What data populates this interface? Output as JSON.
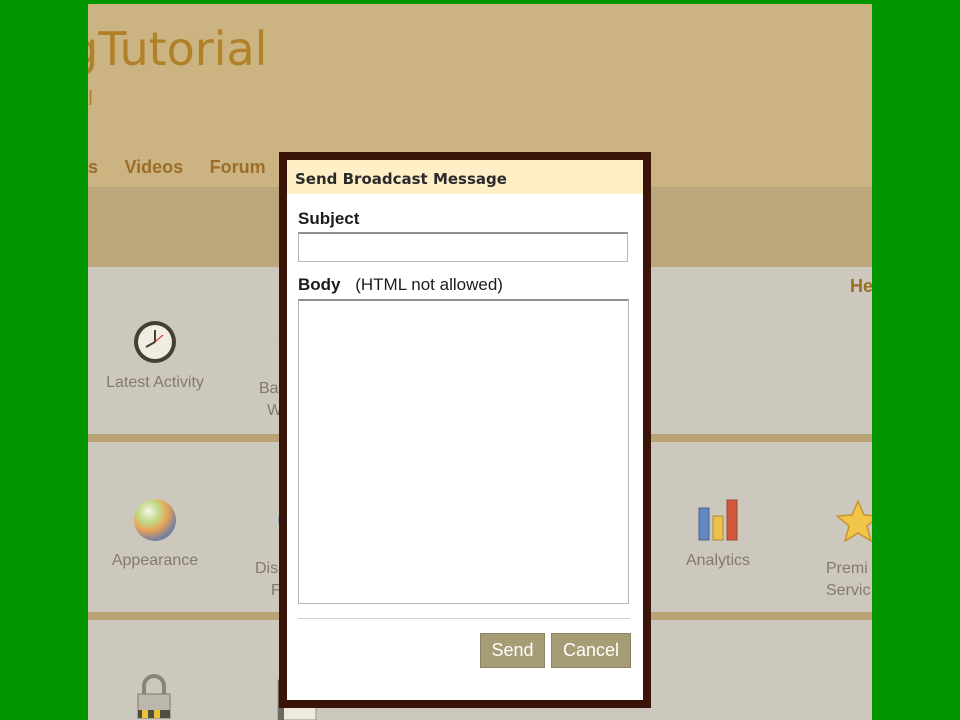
{
  "site": {
    "title": "ngTutorial",
    "tagline": "eal",
    "nav": [
      "bers",
      "Videos",
      "Forum"
    ],
    "help_fragment": "He"
  },
  "tiles": [
    {
      "label": "Latest Activity",
      "icon": "clock-icon"
    },
    {
      "label": "Ba\nW",
      "icon": "badges-icon"
    },
    {
      "label": "Appearance",
      "icon": "appearance-orb-icon"
    },
    {
      "label": "Dis\nF",
      "icon": "discussion-icon"
    },
    {
      "label": "Analytics",
      "icon": "bar-chart-icon"
    },
    {
      "label": "Premi\nServic",
      "icon": "star-icon"
    },
    {
      "label": "",
      "icon": "lock-icon"
    },
    {
      "label": "",
      "icon": "document-icon"
    }
  ],
  "modal": {
    "title": "Send Broadcast Message",
    "subject_label": "Subject",
    "subject_value": "",
    "body_label": "Body",
    "body_note": "(HTML not allowed)",
    "body_value": "",
    "send_label": "Send",
    "cancel_label": "Cancel"
  },
  "colors": {
    "outer_background": "#009400",
    "header_background": "#c6b07f",
    "title_color": "#a57214",
    "modal_border": "#3a1408",
    "modal_header": "#ffefc6",
    "button": "#a69d76"
  }
}
